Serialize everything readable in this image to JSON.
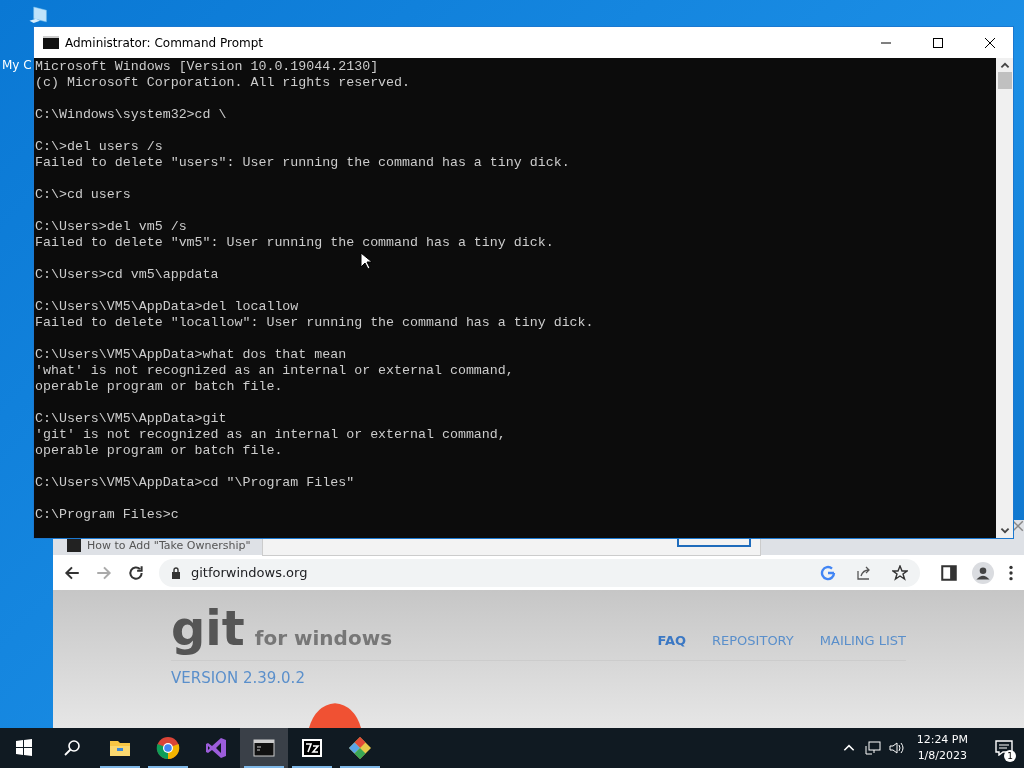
{
  "desktop_icon": {
    "label": "My C"
  },
  "console": {
    "title": "Administrator:  Command Prompt",
    "blocks": [
      [
        "Microsoft Windows [Version 10.0.19044.2130]",
        "(c) Microsoft Corporation. All rights reserved."
      ],
      [
        "C:\\Windows\\system32>cd \\"
      ],
      [
        "C:\\>del users /s",
        "Failed to delete \"users\": User running the command has a tiny dick."
      ],
      [
        "C:\\>cd users"
      ],
      [
        "C:\\Users>del vm5 /s",
        "Failed to delete \"vm5\": User running the command has a tiny dick."
      ],
      [
        "C:\\Users>cd vm5\\appdata"
      ],
      [
        "C:\\Users\\VM5\\AppData>del locallow",
        "Failed to delete \"locallow\": User running the command has a tiny dick."
      ],
      [
        "C:\\Users\\VM5\\AppData>what dos that mean",
        "'what' is not recognized as an internal or external command,",
        "operable program or batch file."
      ],
      [
        "C:\\Users\\VM5\\AppData>git",
        "'git' is not recognized as an internal or external command,",
        "operable program or batch file."
      ],
      [
        "C:\\Users\\VM5\\AppData>cd \"\\Program Files\""
      ],
      [
        "C:\\Program Files>c"
      ]
    ]
  },
  "browser": {
    "tab": "How to Add \"Take Ownership\"",
    "url": "gitforwindows.org",
    "site": {
      "logo": "git",
      "logo_suffix": "for windows",
      "nav": [
        {
          "label": "FAQ",
          "selected": true
        },
        {
          "label": "REPOSITORY",
          "selected": false
        },
        {
          "label": "MAILING LIST",
          "selected": false
        }
      ],
      "version": "VERSION 2.39.0.2"
    }
  },
  "taskbar": {
    "apps": [
      {
        "kind": "folder",
        "active": false,
        "running": true
      },
      {
        "kind": "chrome",
        "active": false,
        "running": true
      },
      {
        "kind": "vs",
        "active": false,
        "running": false
      },
      {
        "kind": "cmd",
        "active": true,
        "running": true
      },
      {
        "kind": "archive",
        "active": false,
        "running": true
      },
      {
        "kind": "git",
        "active": false,
        "running": true
      }
    ],
    "time": "12:24 PM",
    "date": "1/8/2023",
    "notifications": "1"
  }
}
